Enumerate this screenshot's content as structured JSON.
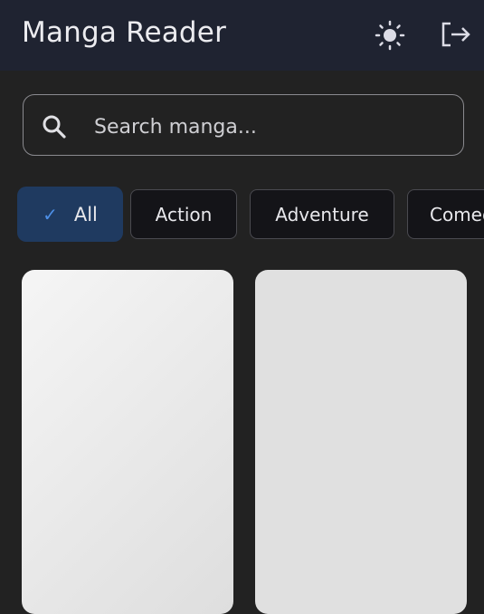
{
  "header": {
    "title": "Manga Reader",
    "icons": [
      "sun-icon",
      "logout-icon"
    ]
  },
  "search": {
    "placeholder": "Search manga..."
  },
  "genres": [
    {
      "label": "All",
      "selected": true
    },
    {
      "label": "Action"
    },
    {
      "label": "Adventure"
    },
    {
      "label": "Comedy"
    }
  ],
  "colors": {
    "header": "#1f2331",
    "background": "#222222",
    "selected_chip": "#1f3a60",
    "check": "#4d8fe6"
  }
}
